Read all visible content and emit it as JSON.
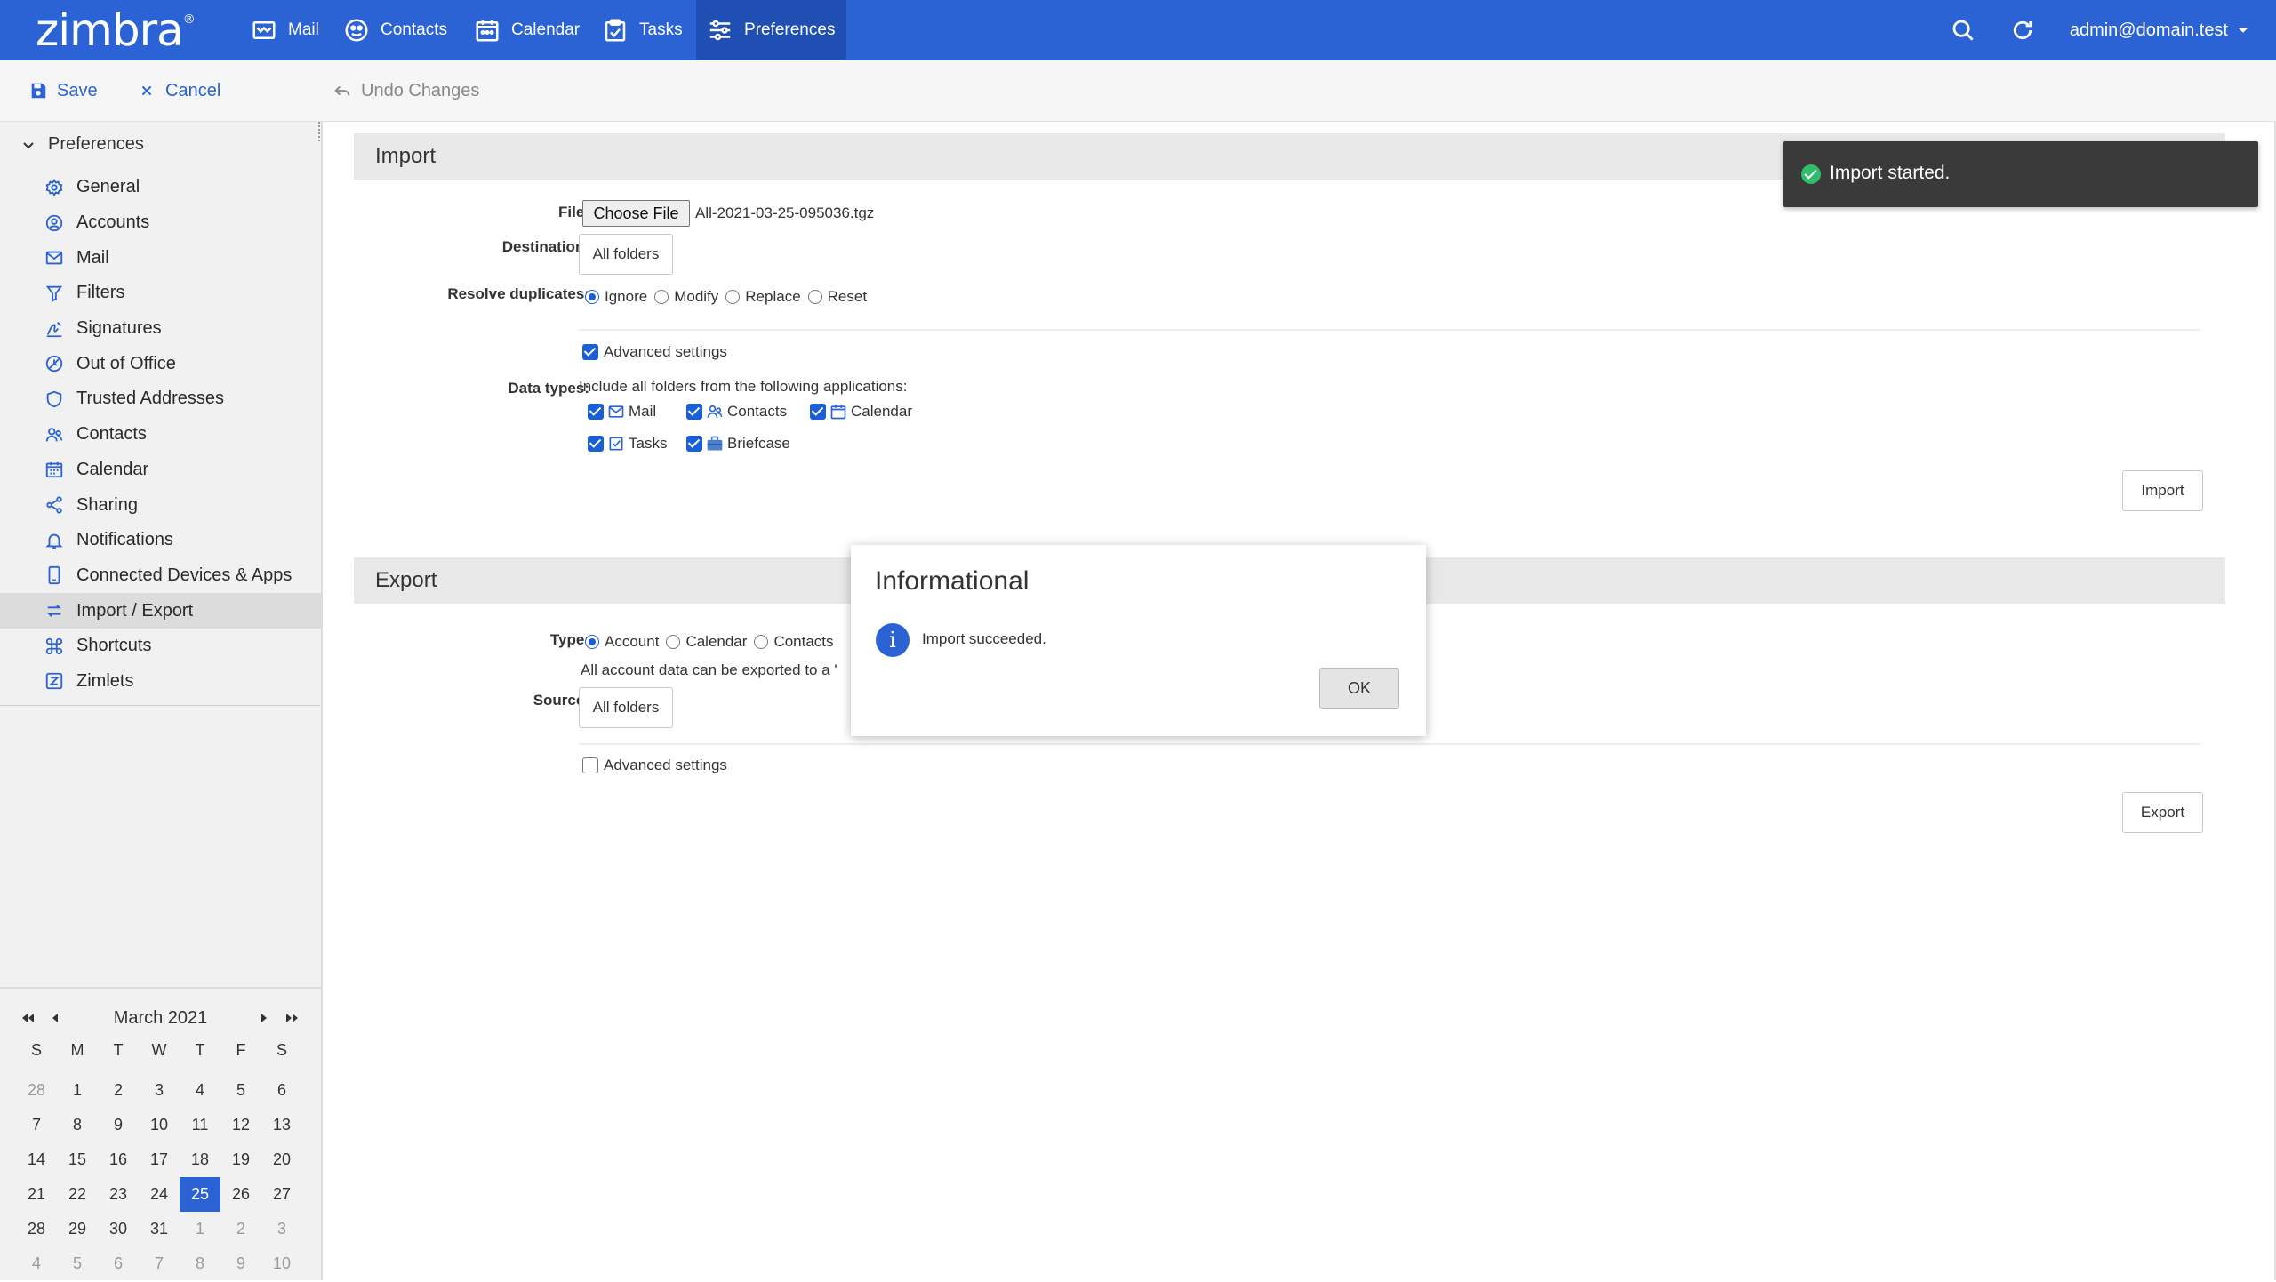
{
  "app": {
    "logo": "zimbra",
    "logo_mark": "®",
    "user": "admin@domain.test"
  },
  "nav": [
    {
      "label": "Mail",
      "icon": "mail-icon"
    },
    {
      "label": "Contacts",
      "icon": "contacts-icon"
    },
    {
      "label": "Calendar",
      "icon": "calendar-icon"
    },
    {
      "label": "Tasks",
      "icon": "tasks-icon"
    },
    {
      "label": "Preferences",
      "icon": "preferences-icon",
      "active": true
    }
  ],
  "toolbar": {
    "save": "Save",
    "cancel": "Cancel",
    "undo": "Undo Changes"
  },
  "sidebar": {
    "header": "Preferences",
    "items": [
      {
        "label": "General",
        "icon": "gear-icon"
      },
      {
        "label": "Accounts",
        "icon": "account-icon"
      },
      {
        "label": "Mail",
        "icon": "mail-icon"
      },
      {
        "label": "Filters",
        "icon": "filter-icon"
      },
      {
        "label": "Signatures",
        "icon": "signature-icon"
      },
      {
        "label": "Out of Office",
        "icon": "out-of-office-icon"
      },
      {
        "label": "Trusted Addresses",
        "icon": "shield-icon"
      },
      {
        "label": "Contacts",
        "icon": "contacts-icon"
      },
      {
        "label": "Calendar",
        "icon": "calendar-icon"
      },
      {
        "label": "Sharing",
        "icon": "share-icon"
      },
      {
        "label": "Notifications",
        "icon": "bell-icon"
      },
      {
        "label": "Connected Devices & Apps",
        "icon": "device-icon"
      },
      {
        "label": "Import / Export",
        "icon": "import-export-icon",
        "active": true
      },
      {
        "label": "Shortcuts",
        "icon": "command-icon"
      },
      {
        "label": "Zimlets",
        "icon": "zimlet-icon"
      }
    ]
  },
  "calendar": {
    "title": "March 2021",
    "dow": [
      "S",
      "M",
      "T",
      "W",
      "T",
      "F",
      "S"
    ],
    "weeks": [
      [
        "28",
        "1",
        "2",
        "3",
        "4",
        "5",
        "6"
      ],
      [
        "7",
        "8",
        "9",
        "10",
        "11",
        "12",
        "13"
      ],
      [
        "14",
        "15",
        "16",
        "17",
        "18",
        "19",
        "20"
      ],
      [
        "21",
        "22",
        "23",
        "24",
        "25",
        "26",
        "27"
      ],
      [
        "28",
        "29",
        "30",
        "31",
        "1",
        "2",
        "3"
      ],
      [
        "4",
        "5",
        "6",
        "7",
        "8",
        "9",
        "10"
      ]
    ],
    "today": "25"
  },
  "import": {
    "title": "Import",
    "file_label": "File:",
    "choose_file": "Choose File",
    "file_name": "All-2021-03-25-095036.tgz",
    "destination_label": "Destination:",
    "destination_value": "All folders",
    "resolve_label": "Resolve duplicates:",
    "resolve_options": [
      "Ignore",
      "Modify",
      "Replace",
      "Reset"
    ],
    "resolve_selected": "Ignore",
    "advanced": "Advanced settings",
    "data_types_label": "Data types:",
    "data_types_desc": "Include all folders from the following applications:",
    "data_types": [
      "Mail",
      "Contacts",
      "Calendar",
      "Tasks",
      "Briefcase"
    ],
    "button": "Import"
  },
  "export": {
    "title": "Export",
    "type_label": "Type:",
    "type_options": [
      "Account",
      "Calendar",
      "Contacts"
    ],
    "type_selected": "Account",
    "type_desc": "All account data can be exported to a '",
    "source_label": "Source:",
    "source_value": "All folders",
    "advanced": "Advanced settings",
    "button": "Export"
  },
  "dialog": {
    "title": "Informational",
    "message": "Import succeeded.",
    "ok": "OK",
    "info_glyph": "i"
  },
  "toast": {
    "message": "Import started."
  },
  "colors": {
    "brand": "#2b63d4",
    "success": "#2fbe6a",
    "toast_bg": "#3a3a3a"
  }
}
